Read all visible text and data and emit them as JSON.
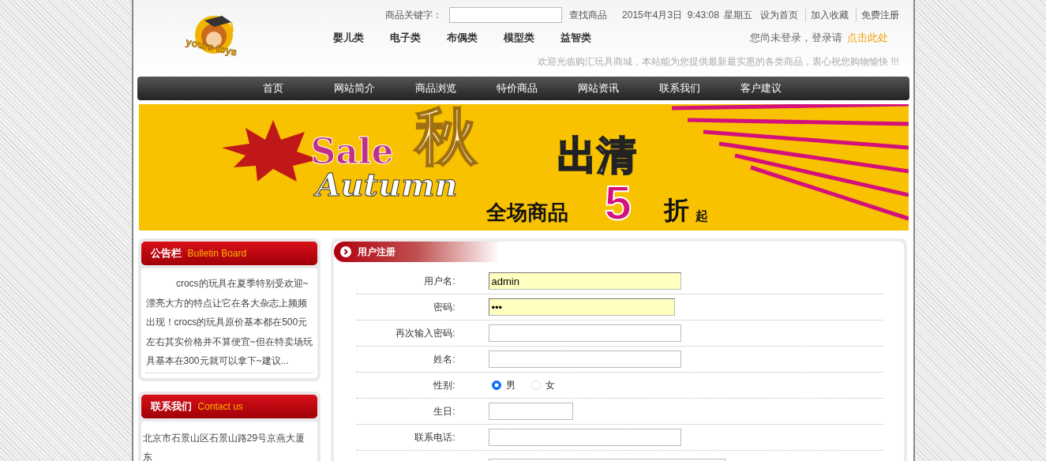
{
  "header": {
    "logo_text": "yours toys",
    "search_label": "商品关键字：",
    "search_button": "查找商品",
    "datetime": "2015年4月3日  9:43:08  星期五",
    "top_links": [
      "设为首页",
      "加入收藏",
      "免费注册"
    ],
    "categories": [
      "婴儿类",
      "电子类",
      "布偶类",
      "模型类",
      "益智类"
    ],
    "login_prompt": "您尚未登录，登录请",
    "login_link": "点击此处",
    "welcome": "欢迎光临购汇玩具商城，本站能为您提供最新最实惠的各类商品，衷心祝您购物愉快  !!!"
  },
  "nav": [
    {
      "label": "首页"
    },
    {
      "label": "网站简介"
    },
    {
      "label": "商品浏览"
    },
    {
      "label": "特价商品"
    },
    {
      "label": "网站资讯"
    },
    {
      "label": "联系我们"
    },
    {
      "label": "客户建议"
    }
  ],
  "banner": {
    "sale": "Sale",
    "autumn_char": "秋",
    "clearance": "出清",
    "autumn": "Autumn",
    "all_goods": "全场商品",
    "discount": "5",
    "zhe": "折",
    "qi": "起"
  },
  "sidebar": [
    {
      "title": "公告栏",
      "subtitle": "Bulletin Board",
      "text": "crocs的玩具在夏季特别受欢迎~漂亮大方的特点让它在各大杂志上频频出现！crocs的玩具原价基本都在500元左右其实价格并不算便宜~但在特卖场玩具基本在300元就可以拿下~建议...",
      "indent": true
    },
    {
      "title": "联系我们",
      "subtitle": "Contact us",
      "text": "北京市石景山区石景山路29号京燕大厦东",
      "indent": false
    }
  ],
  "form": {
    "title": "用户注册",
    "fields": [
      {
        "kind": "text",
        "label": "用户名:",
        "value": "admin"
      },
      {
        "kind": "password",
        "label": "密码:",
        "value": "•••"
      },
      {
        "kind": "password",
        "label": "再次输入密码:"
      },
      {
        "kind": "text",
        "label": "姓名:"
      },
      {
        "kind": "radio",
        "label": "性别:",
        "options": [
          {
            "label": "男",
            "selected": true
          },
          {
            "label": "女",
            "selected": false
          }
        ]
      },
      {
        "kind": "date",
        "label": "生日:"
      },
      {
        "kind": "text",
        "label": "联系电话:"
      },
      {
        "kind": "textarea"
      }
    ]
  }
}
